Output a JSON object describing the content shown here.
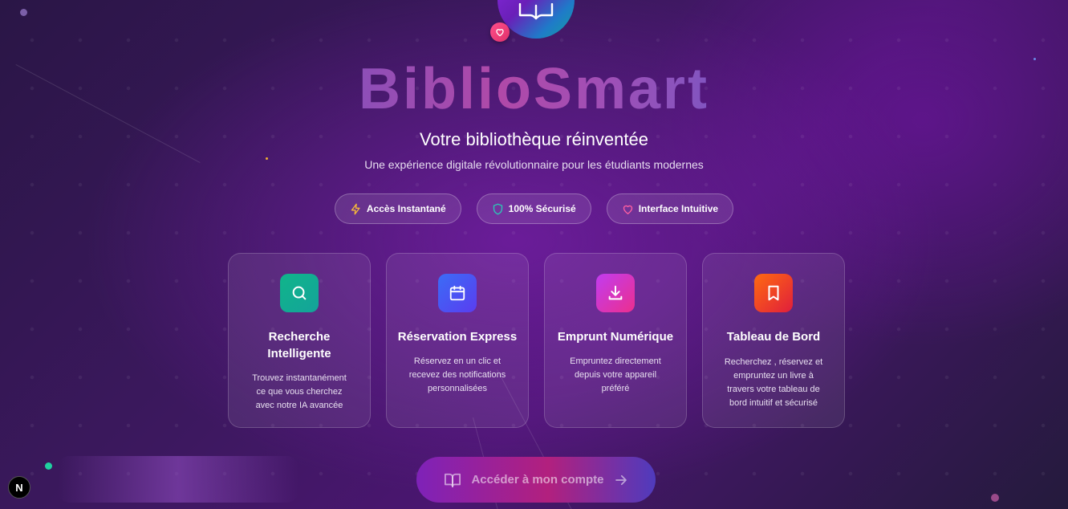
{
  "app": {
    "title": "BiblioSmart",
    "subtitle": "Votre bibliothèque réinventée",
    "tagline": "Une expérience digitale révolutionnaire pour les étudiants modernes",
    "logo_icon": "book-open-icon",
    "badge_icon": "heart-icon"
  },
  "features": [
    {
      "label": "Accès Instantané",
      "icon": "lightning-icon",
      "color": "#f5b83a"
    },
    {
      "label": "100% Sécurisé",
      "icon": "shield-icon",
      "color": "#2ec4b6"
    },
    {
      "label": "Interface Intuitive",
      "icon": "heart-icon",
      "color": "#ff5fa2"
    }
  ],
  "cards": [
    {
      "title": "Recherche Intelligente",
      "description": "Trouvez instantanément ce que vous cherchez avec notre IA avancée",
      "icon": "search-icon",
      "colors": [
        "#10b58a",
        "#14a39a"
      ]
    },
    {
      "title": "Réservation Express",
      "description": "Réservez en un clic et recevez des notifications personnalisées",
      "icon": "calendar-icon",
      "colors": [
        "#3b6cf6",
        "#5a3df0"
      ]
    },
    {
      "title": "Emprunt Numérique",
      "description": "Empruntez directement depuis votre appareil préféré",
      "icon": "download-icon",
      "colors": [
        "#c13cf0",
        "#ec2f8e"
      ]
    },
    {
      "title": "Tableau de Bord",
      "description": "Recherchez , réservez et empruntez un livre à travers votre tableau de bord intuitif et sécurisé",
      "icon": "bookmark-icon",
      "colors": [
        "#ff6a10",
        "#e01e3c"
      ]
    }
  ],
  "cta": {
    "label": "Accéder à mon compte",
    "icon": "book-open-icon",
    "arrow_icon": "arrow-right-icon"
  },
  "dev_badge": {
    "label": "N"
  }
}
